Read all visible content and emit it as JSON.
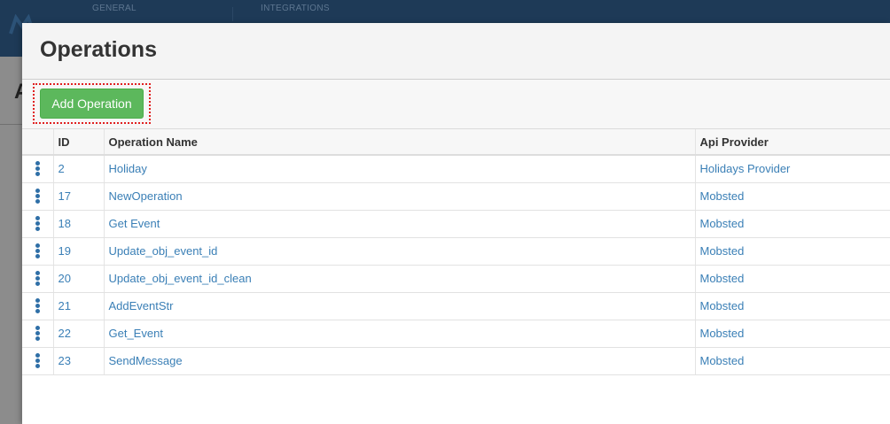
{
  "app": {
    "nav": [
      "GENERAL",
      "INTEGRATIONS"
    ],
    "background_title": "A"
  },
  "modal": {
    "title": "Operations",
    "add_button_label": "Add Operation"
  },
  "table": {
    "columns": [
      "ID",
      "Operation Name",
      "Api Provider"
    ],
    "rows": [
      {
        "id": "2",
        "name": "Holiday",
        "provider": "Holidays Provider"
      },
      {
        "id": "17",
        "name": "NewOperation",
        "provider": "Mobsted"
      },
      {
        "id": "18",
        "name": "Get Event",
        "provider": "Mobsted"
      },
      {
        "id": "19",
        "name": "Update_obj_event_id",
        "provider": "Mobsted"
      },
      {
        "id": "20",
        "name": "Update_obj_event_id_clean",
        "provider": "Mobsted"
      },
      {
        "id": "21",
        "name": "AddEventStr",
        "provider": "Mobsted"
      },
      {
        "id": "22",
        "name": "Get_Event",
        "provider": "Mobsted"
      },
      {
        "id": "23",
        "name": "SendMessage",
        "provider": "Mobsted"
      }
    ]
  },
  "colors": {
    "add_button": "#5cb85c",
    "link": "#3a7fb6",
    "highlight": "#e02020",
    "topbar": "#1e3a57"
  },
  "icons": {
    "row_menu": "kebab-menu-icon",
    "logo": "app-logo-icon"
  }
}
